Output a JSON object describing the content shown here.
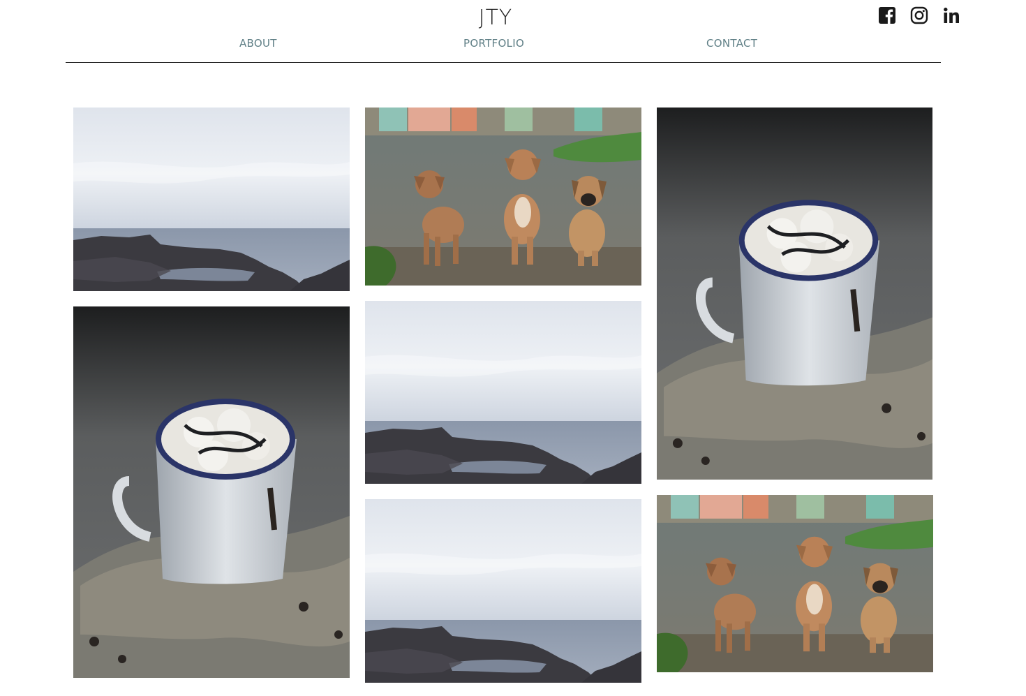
{
  "header": {
    "site_title": "JTY",
    "nav": [
      {
        "label": "ABOUT"
      },
      {
        "label": "PORTFOLIO"
      },
      {
        "label": "CONTACT"
      }
    ],
    "social": [
      {
        "icon": "facebook-icon"
      },
      {
        "icon": "instagram-icon"
      },
      {
        "icon": "linkedin-icon"
      }
    ]
  },
  "gallery": {
    "photos": [
      {
        "subject": "seascape"
      },
      {
        "subject": "puppies"
      },
      {
        "subject": "cocoa-mug"
      },
      {
        "subject": "cocoa-mug"
      },
      {
        "subject": "seascape"
      },
      {
        "subject": "seascape"
      },
      {
        "subject": "puppies"
      }
    ]
  },
  "colors": {
    "nav_text": "#5f7f86",
    "title_text": "#222222",
    "divider": "#222222"
  }
}
